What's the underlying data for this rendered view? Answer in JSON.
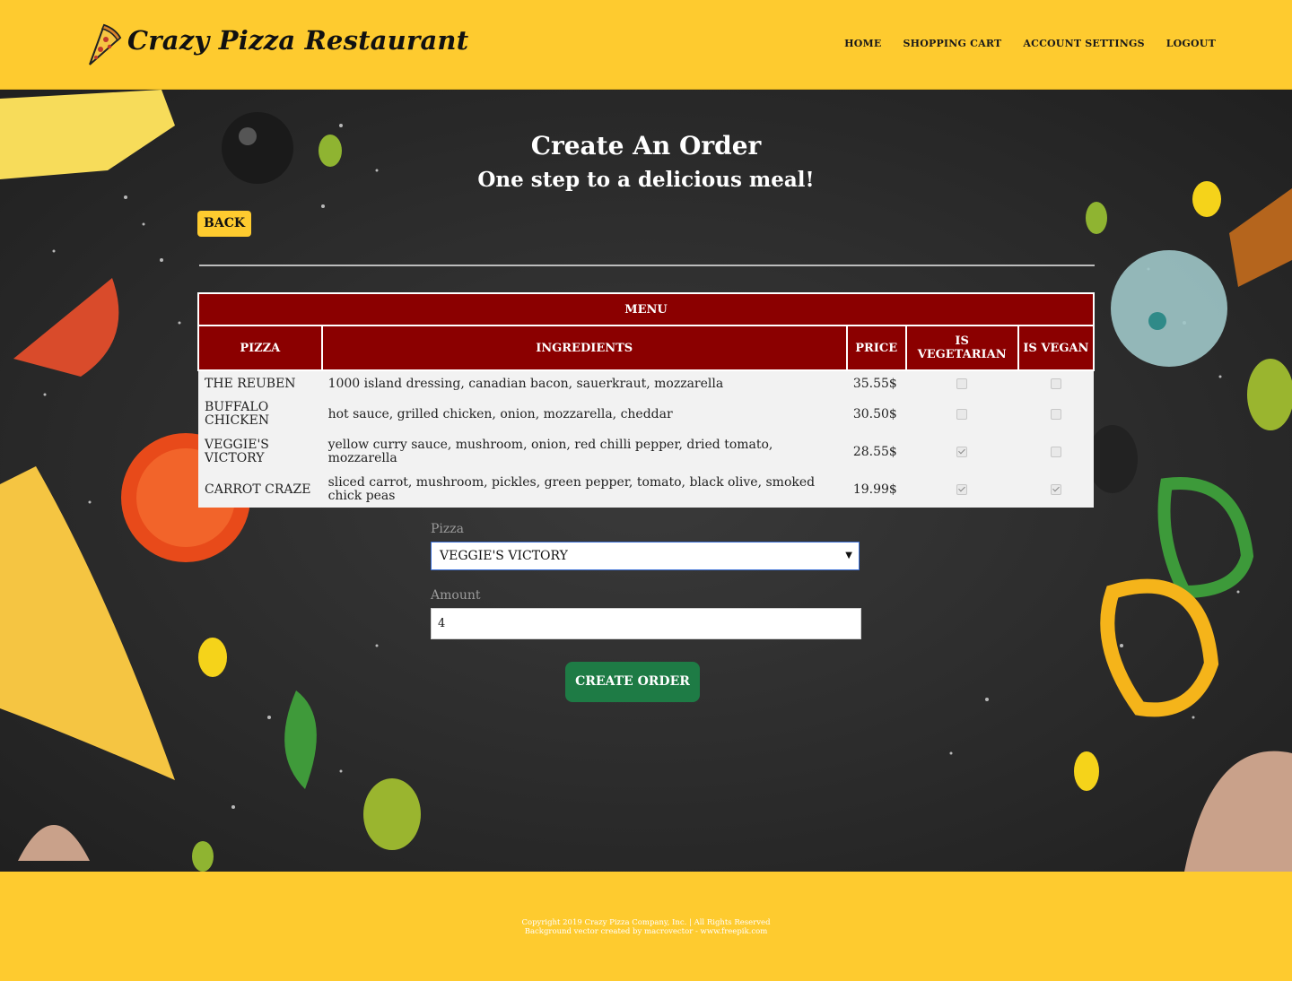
{
  "header": {
    "brand": "Crazy Pizza Restaurant",
    "nav": [
      "HOME",
      "SHOPPING CART",
      "ACCOUNT SETTINGS",
      "LOGOUT"
    ]
  },
  "page": {
    "title": "Create An Order",
    "subtitle": "One step to a delicious meal!",
    "back_label": "BACK"
  },
  "menu": {
    "caption": "MENU",
    "columns": [
      "PIZZA",
      "INGREDIENTS",
      "PRICE",
      "IS VEGETARIAN",
      "IS VEGAN"
    ],
    "rows": [
      {
        "pizza": "THE REUBEN",
        "ingredients": "1000 island dressing, canadian bacon, sauerkraut, mozzarella",
        "price": "35.55$",
        "vegetarian": false,
        "vegan": false
      },
      {
        "pizza": "BUFFALO CHICKEN",
        "ingredients": "hot sauce, grilled chicken, onion, mozzarella, cheddar",
        "price": "30.50$",
        "vegetarian": false,
        "vegan": false
      },
      {
        "pizza": "VEGGIE'S VICTORY",
        "ingredients": "yellow curry sauce, mushroom, onion, red chilli pepper, dried tomato, mozzarella",
        "price": "28.55$",
        "vegetarian": true,
        "vegan": false
      },
      {
        "pizza": "CARROT CRAZE",
        "ingredients": "sliced carrot, mushroom, pickles, green pepper, tomato, black olive, smoked chick peas",
        "price": "19.99$",
        "vegetarian": true,
        "vegan": true
      }
    ]
  },
  "form": {
    "pizza_label": "Pizza",
    "pizza_selected": "VEGGIE'S VICTORY",
    "amount_label": "Amount",
    "amount_value": "4",
    "submit_label": "CREATE ORDER"
  },
  "footer": {
    "line1": "Copyright 2019 Crazy Pizza Company, Inc. | All Rights Reserved",
    "line2": "Background vector created by macrovector - www.freepik.com"
  },
  "colors": {
    "brand_yellow": "#fecb2f",
    "table_header": "#8b0000",
    "submit_green": "#1e7b45",
    "background_dark": "#2b2b2b"
  }
}
